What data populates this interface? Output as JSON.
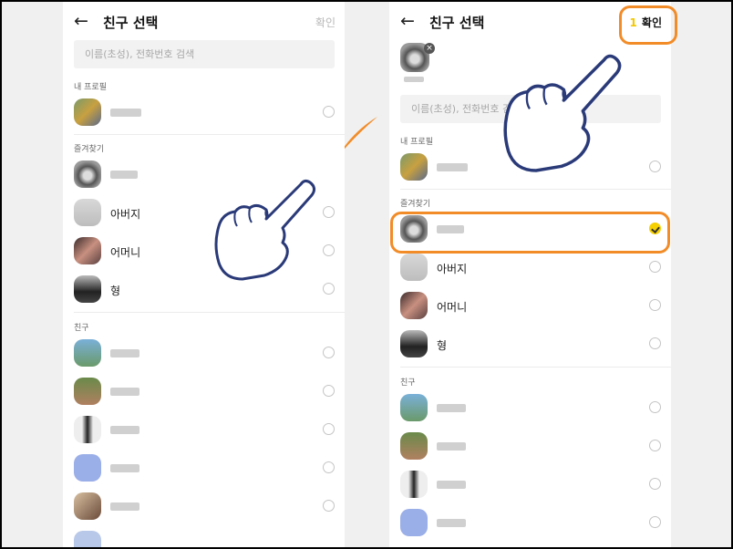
{
  "left": {
    "title": "친구 선택",
    "confirm": "확인",
    "search_placeholder": "이름(초성), 전화번호 검색",
    "sections": {
      "my_profile": "내 프로필",
      "favorites": "즐겨찾기",
      "friends": "친구"
    },
    "favorites": [
      "아버지",
      "어머니",
      "형"
    ]
  },
  "right": {
    "title": "친구 선택",
    "count": "1",
    "confirm": "확인",
    "search_placeholder": "이름(초성), 전화번호 검색",
    "sections": {
      "my_profile": "내 프로필",
      "favorites": "즐겨찾기",
      "friends": "친구"
    },
    "favorites": [
      "아버지",
      "어머니",
      "형"
    ]
  },
  "colors": {
    "accent_orange": "#f28c28",
    "check_yellow": "#f7d000"
  }
}
